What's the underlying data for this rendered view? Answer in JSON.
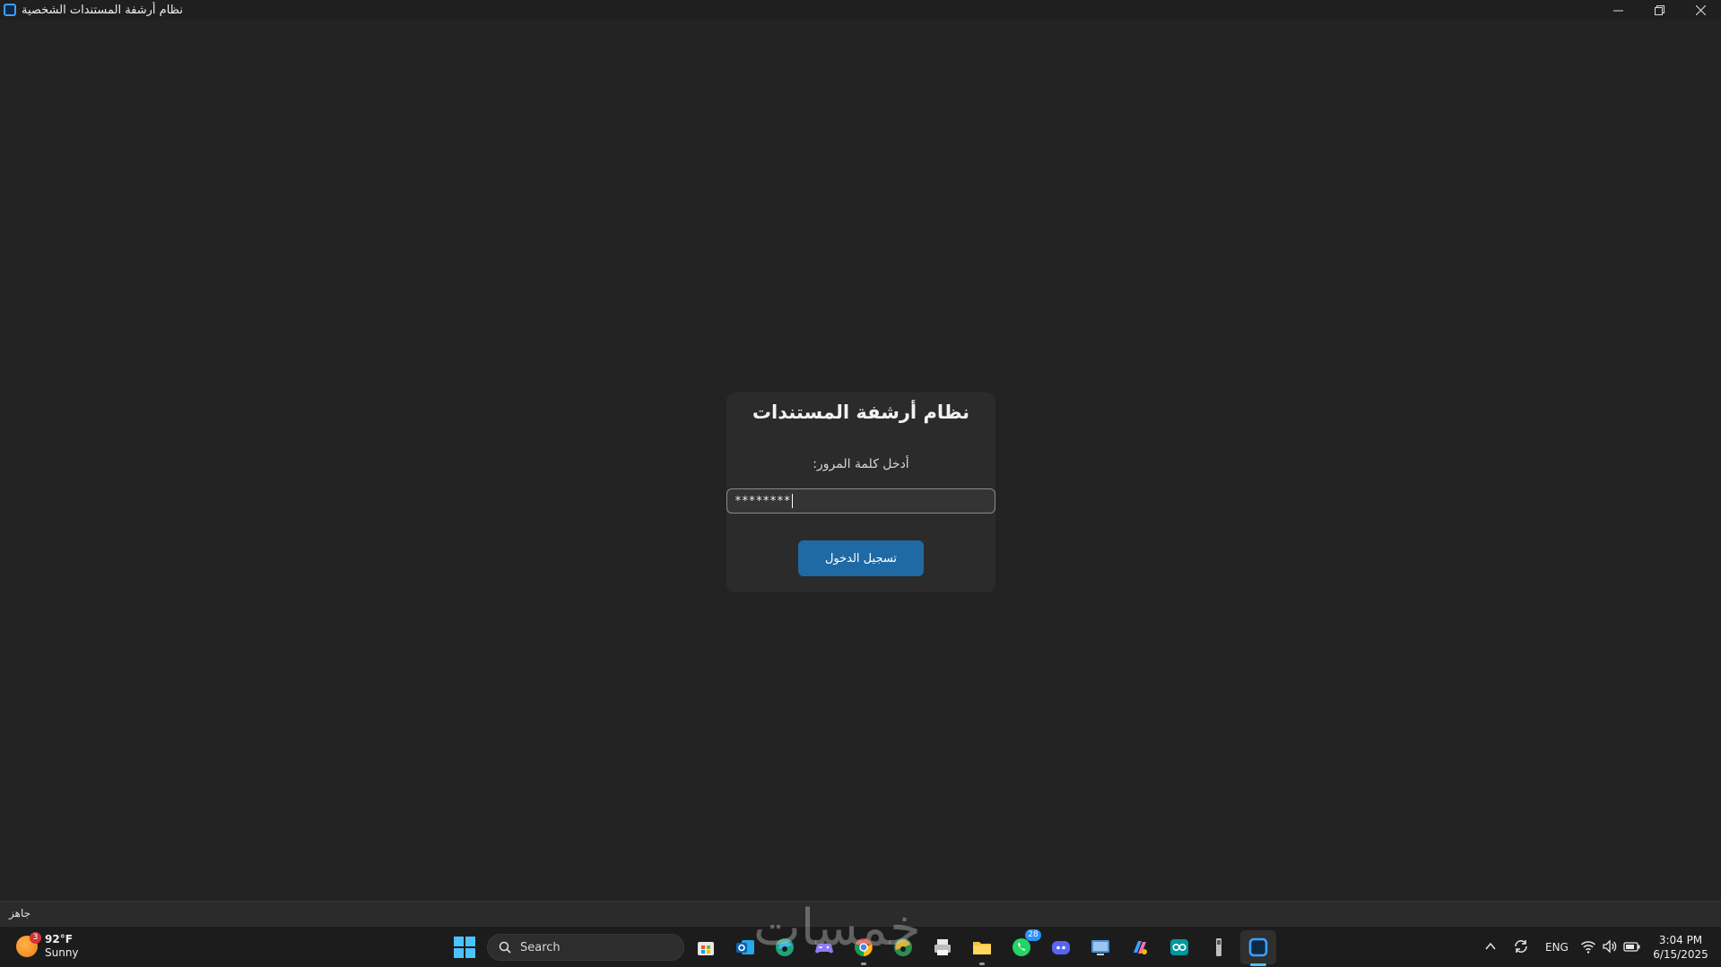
{
  "window": {
    "title": "نظام أرشفة المستندات الشخصية",
    "controls": [
      "minimize",
      "restore",
      "close"
    ]
  },
  "login": {
    "heading": "نظام أرشفة المستندات",
    "password_label": "أدخل كلمة المرور:",
    "password_value": "********",
    "submit_label": "تسجيل الدخول"
  },
  "status": {
    "text": "جاهز"
  },
  "watermark": {
    "text": "خمسات"
  },
  "taskbar": {
    "weather": {
      "temp": "92°F",
      "condition": "Sunny",
      "badge": "3"
    },
    "search_label": "Search",
    "apps": [
      {
        "name": "microsoft-store-icon"
      },
      {
        "name": "outlook-icon"
      },
      {
        "name": "edge-icon"
      },
      {
        "name": "game-controller-icon"
      },
      {
        "name": "chrome-icon"
      },
      {
        "name": "edge-dev-icon"
      },
      {
        "name": "printer-icon"
      },
      {
        "name": "file-explorer-icon"
      },
      {
        "name": "whatsapp-icon",
        "badge": "28"
      },
      {
        "name": "discord-icon"
      },
      {
        "name": "remote-desktop-icon"
      },
      {
        "name": "copilot-icon"
      },
      {
        "name": "arduino-icon"
      },
      {
        "name": "device-icon"
      },
      {
        "name": "archive-app-icon"
      }
    ],
    "tray": {
      "language": "ENG",
      "time": "3:04 PM",
      "date": "6/15/2025"
    }
  },
  "colors": {
    "background": "#232323",
    "card": "#2b2b2b",
    "accent_button": "#1f6aa5",
    "taskbar": "#1c1c1c"
  }
}
